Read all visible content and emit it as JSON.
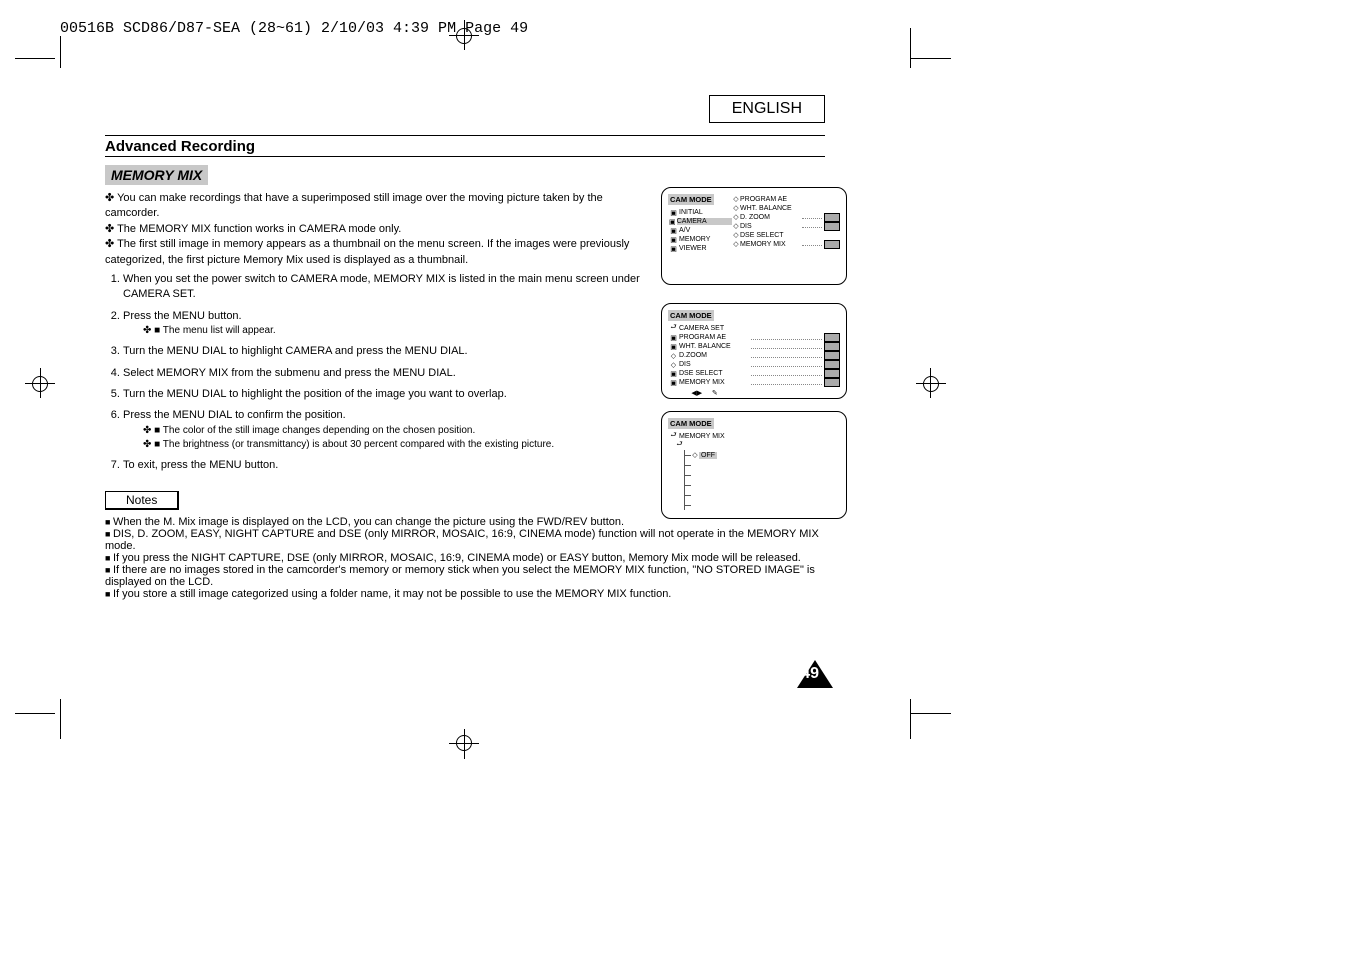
{
  "header_strip": "00516B SCD86/D87-SEA (28~61)  2/10/03 4:39 PM  Page 49",
  "lang": "ENGLISH",
  "page_title": "Advanced Recording",
  "section": "MEMORY MIX",
  "intro": [
    "You can make recordings that have a superimposed still image over the moving picture taken by the camcorder.",
    "The MEMORY MIX function works in CAMERA mode only.",
    "The first still image in memory appears as a thumbnail on the menu screen. If the images were previously categorized, the first picture Memory Mix used is displayed as a thumbnail."
  ],
  "steps": [
    {
      "t": "When you set the power switch to CAMERA mode, MEMORY MIX is listed in the main menu screen under CAMERA SET."
    },
    {
      "t": "Press the MENU button.",
      "sub": [
        "The menu list will appear."
      ]
    },
    {
      "t": "Turn the MENU DIAL to highlight CAMERA and press the MENU DIAL."
    },
    {
      "t": "Select MEMORY MIX from the submenu and press the MENU DIAL."
    },
    {
      "t": "Turn the MENU DIAL to highlight the position of the image you want to overlap."
    },
    {
      "t": "Press the MENU DIAL to confirm the position.",
      "sub": [
        "The color of the still image changes depending on the chosen position.",
        "The brightness (or transmittancy) is about 30 percent compared with the existing picture."
      ]
    },
    {
      "t": "To exit, press the MENU button."
    }
  ],
  "notes_label": "Notes",
  "notes": [
    "When the M. Mix image is displayed on the LCD, you can change the picture using the FWD/REV button.",
    "DIS, D. ZOOM, EASY, NIGHT CAPTURE and DSE (only MIRROR, MOSAIC, 16:9, CINEMA mode) function will not operate in the MEMORY MIX mode.",
    "If you press the NIGHT CAPTURE, DSE (only MIRROR, MOSAIC, 16:9, CINEMA mode) or EASY button, Memory Mix mode will be released.",
    "If there are no images stored in the camcorder's memory or memory stick when you select the MEMORY MIX function, \"NO STORED IMAGE\" is displayed on the LCD.",
    "If you store a still image categorized using a folder name, it may not be possible to use the MEMORY MIX function."
  ],
  "page_number": "49",
  "osd1": {
    "title": "CAM MODE",
    "items": [
      {
        "ico": "▣",
        "lab": "INITIAL"
      },
      {
        "ico": "▣",
        "lab": "CAMERA",
        "sel": true,
        "sub": [
          "PROGRAM AE",
          "WHT. BALANCE",
          "D. ZOOM",
          "DIS",
          "DSE SELECT",
          "MEMORY MIX"
        ]
      },
      {
        "ico": "▣",
        "lab": "A/V"
      },
      {
        "ico": "▣",
        "lab": "MEMORY"
      },
      {
        "ico": "▣",
        "lab": "VIEWER"
      }
    ]
  },
  "osd2": {
    "title": "CAM MODE",
    "back": "CAMERA SET",
    "items": [
      {
        "ico": "▣",
        "lab": "PROGRAM AE"
      },
      {
        "ico": "▣",
        "lab": "WHT. BALANCE"
      },
      {
        "ico": "◇",
        "lab": "D.ZOOM"
      },
      {
        "ico": "◇",
        "lab": "DIS"
      },
      {
        "ico": "▣",
        "lab": "DSE SELECT"
      },
      {
        "ico": "▣",
        "lab": "MEMORY MIX"
      }
    ]
  },
  "osd3": {
    "title": "CAM MODE",
    "back": "MEMORY MIX",
    "sel": "OFF",
    "positions": [
      "",
      "",
      "",
      "",
      ""
    ]
  }
}
